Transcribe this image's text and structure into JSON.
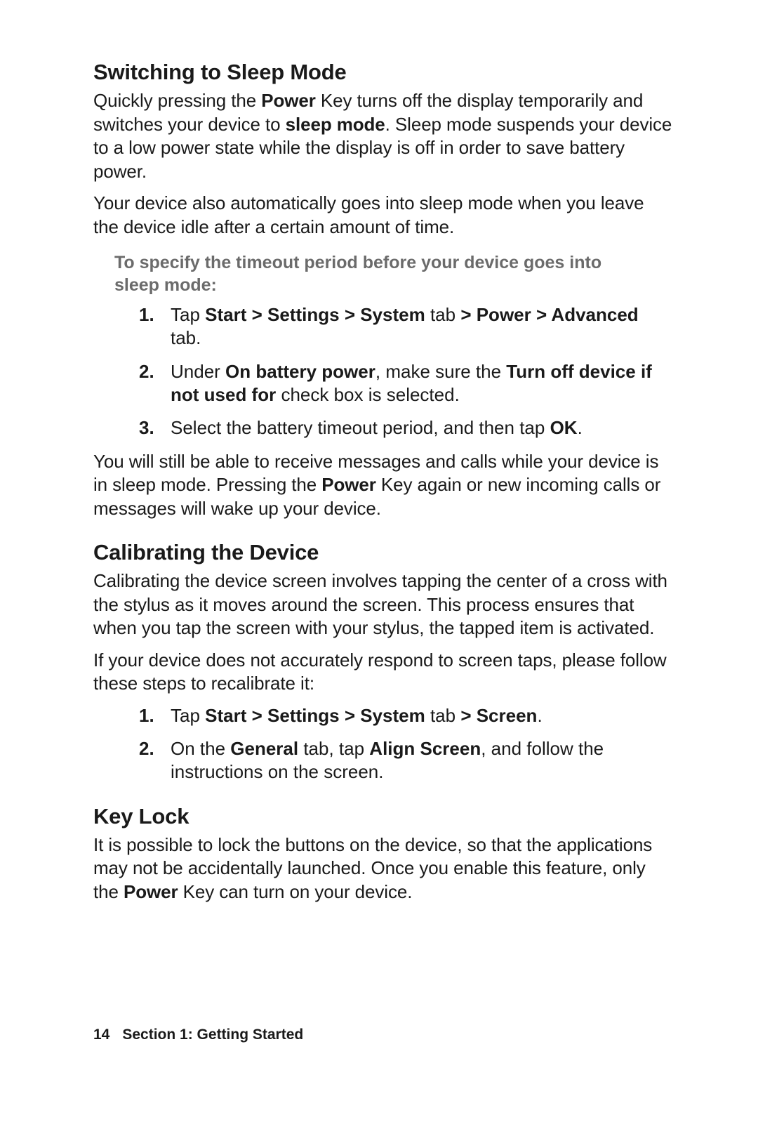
{
  "sections": {
    "sleep": {
      "heading": "Switching to Sleep Mode",
      "p1": {
        "a": "Quickly pressing the ",
        "b": "Power",
        "c": " Key turns off the display temporarily and switches your device to ",
        "d": "sleep mode",
        "e": ". Sleep mode suspends your device to a low power state while the display is off in order to save battery power."
      },
      "p2": "Your device also automatically goes into sleep mode when you leave the device idle after a certain amount of time.",
      "sub_intro": "To specify the timeout period before your device goes into sleep mode:",
      "steps": {
        "s1": {
          "a": "Tap ",
          "b": "Start > Settings > System",
          "c": " tab ",
          "d": "> Power > Advanced",
          "e": " tab."
        },
        "s2": {
          "a": "Under ",
          "b": "On battery power",
          "c": ", make sure the ",
          "d": "Turn off device if not used for",
          "e": " check box is selected."
        },
        "s3": {
          "a": "Select the battery timeout period, and then tap ",
          "b": "OK",
          "c": "."
        }
      },
      "p3": {
        "a": "You will still be able to receive messages and calls while your device is in sleep mode. Pressing the ",
        "b": "Power",
        "c": " Key again or new incoming calls or messages will wake up your device."
      }
    },
    "calibrate": {
      "heading": "Calibrating the Device",
      "p1": "Calibrating the device screen involves tapping the center of a cross with the stylus as it moves around the screen. This process ensures that when you tap the screen with your stylus, the tapped item is activated.",
      "p2": "If your device does not accurately respond to screen taps, please follow these steps to recalibrate it:",
      "steps": {
        "s1": {
          "a": "Tap ",
          "b": "Start > Settings > System",
          "c": " tab ",
          "d": "> Screen",
          "e": "."
        },
        "s2": {
          "a": "On the ",
          "b": "General",
          "c": " tab, tap ",
          "d": "Align Screen",
          "e": ", and follow the instructions on the screen."
        }
      }
    },
    "keylock": {
      "heading": "Key Lock",
      "p1": {
        "a": "It is possible to lock the buttons on the device, so that the applications may not be accidentally launched. Once you enable this feature, only the ",
        "b": "Power",
        "c": " Key can turn on your device."
      }
    }
  },
  "footer": {
    "page_number": "14",
    "section_label": "Section 1: Getting Started"
  }
}
